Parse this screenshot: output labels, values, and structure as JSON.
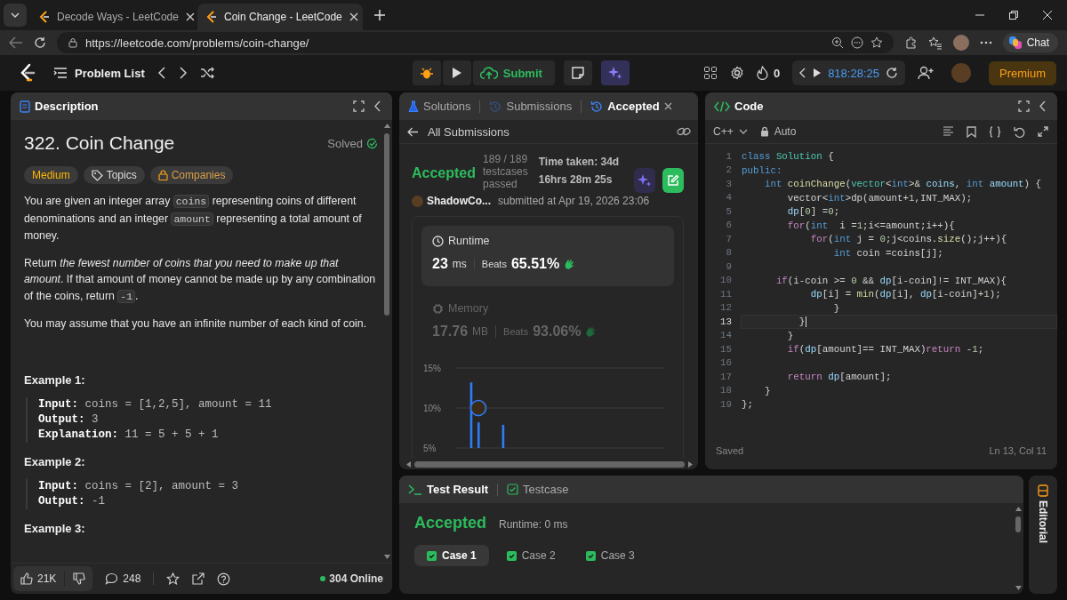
{
  "browser": {
    "tabs": [
      {
        "title": "Decode Ways - LeetCode",
        "selected": false
      },
      {
        "title": "Coin Change - LeetCode",
        "selected": true
      }
    ],
    "url": "https://leetcode.com/problems/coin-change/",
    "chat": "Chat"
  },
  "nav": {
    "problem_list": "Problem List",
    "submit": "Submit",
    "streak": "0",
    "timer": "818:28:25",
    "premium": "Premium"
  },
  "description": {
    "tab": "Description",
    "title": "322. Coin Change",
    "status": "Solved",
    "tags": [
      {
        "label": "Medium",
        "kind": "difficulty"
      },
      {
        "label": "Topics",
        "kind": "topics"
      },
      {
        "label": "Companies",
        "kind": "companies"
      }
    ],
    "paragraphs": [
      [
        {
          "text": "You are given an integer array ",
          "kind": "text"
        },
        {
          "text": "coins",
          "kind": "code"
        },
        {
          "text": " representing coins of different denominations and an integer ",
          "kind": "text"
        },
        {
          "text": "amount",
          "kind": "code"
        },
        {
          "text": " representing a total amount of money.",
          "kind": "text"
        }
      ],
      [
        {
          "text": "Return ",
          "kind": "text"
        },
        {
          "text": "the fewest number of coins that you need to make up that amount",
          "kind": "em"
        },
        {
          "text": ". If that amount of money cannot be made up by any combination of the coins, return ",
          "kind": "text"
        },
        {
          "text": "-1",
          "kind": "code"
        },
        {
          "text": ".",
          "kind": "text"
        }
      ],
      [
        {
          "text": "You may assume that you have an infinite number of each kind of coin.",
          "kind": "text"
        }
      ]
    ],
    "examples": [
      {
        "title": "Example 1:",
        "lines": [
          {
            "label": "Input:",
            "value": "coins = [1,2,5], amount = 11"
          },
          {
            "label": "Output:",
            "value": "3"
          },
          {
            "label": "Explanation:",
            "value": "11 = 5 + 5 + 1"
          }
        ]
      },
      {
        "title": "Example 2:",
        "lines": [
          {
            "label": "Input:",
            "value": "coins = [2], amount = 3"
          },
          {
            "label": "Output:",
            "value": "-1"
          }
        ]
      },
      {
        "title": "Example 3:"
      }
    ],
    "likes": "21K",
    "comments": "248",
    "online": "304 Online"
  },
  "submission": {
    "tabs": [
      {
        "label": "Solutions",
        "selected": false
      },
      {
        "label": "Submissions",
        "selected": false
      },
      {
        "label": "Accepted",
        "selected": true
      }
    ],
    "back": "All Submissions",
    "status": "Accepted",
    "tests": "189 / 189 testcases passed",
    "time_taken": "Time taken: 34d 16hrs 28m 25s",
    "user": "ShadowCo...",
    "submitted": "submitted at Apr 19, 2026 23:06",
    "metrics": [
      {
        "label": "Runtime",
        "value": "23",
        "unit": "ms",
        "beats_label": "Beats",
        "beats": "65.51%",
        "selected": true
      },
      {
        "label": "Memory",
        "value": "17.76",
        "unit": "MB",
        "beats_label": "Beats",
        "beats": "93.06%",
        "selected": false
      }
    ],
    "chart_data": {
      "type": "bar",
      "values": [
        null,
        null,
        null,
        null,
        null,
        null,
        13.2,
        null,
        null,
        8.2,
        null,
        null,
        null,
        null,
        null,
        null,
        null,
        null,
        null,
        7.9,
        null,
        null,
        null,
        null,
        null,
        null,
        null,
        null,
        null,
        null,
        null,
        null,
        null,
        null,
        null,
        null,
        null,
        null,
        null,
        null,
        null,
        null,
        null,
        null,
        null,
        null,
        null,
        null,
        null,
        null,
        null,
        null,
        null,
        null,
        null,
        null,
        null,
        null,
        null,
        null,
        null,
        null,
        null,
        null,
        null,
        null,
        null,
        null,
        null,
        null,
        null,
        null,
        null,
        null,
        null,
        null,
        null,
        null,
        null,
        null,
        null,
        null,
        null,
        null,
        null
      ],
      "ylim": [
        5,
        15
      ],
      "yticks": [
        {
          "value": 15,
          "label": "15%"
        },
        {
          "value": 10,
          "label": "10%"
        },
        {
          "value": 5,
          "label": "5%"
        }
      ]
    }
  },
  "code": {
    "tab": "Code",
    "language": "C++",
    "mode": "Auto",
    "lines": [
      {
        "num": "1",
        "current": false,
        "tokens": [
          {
            "text": "class",
            "kind": "kw"
          },
          {
            "text": " Solution",
            "kind": "type"
          },
          {
            "text": " {",
            "kind": "p"
          }
        ]
      },
      {
        "num": "2",
        "current": false,
        "tokens": [
          {
            "text": "public:",
            "kind": "kw"
          }
        ]
      },
      {
        "num": "3",
        "current": false,
        "tokens": [
          {
            "text": "    int",
            "kind": "kw"
          },
          {
            "text": " coinChange",
            "kind": "fn"
          },
          {
            "text": "(",
            "kind": "p"
          },
          {
            "text": "vector",
            "kind": "type"
          },
          {
            "text": "<",
            "kind": "p"
          },
          {
            "text": "int",
            "kind": "kw"
          },
          {
            "text": ">& ",
            "kind": "p"
          },
          {
            "text": "coins",
            "kind": "var"
          },
          {
            "text": ", ",
            "kind": "p"
          },
          {
            "text": "int",
            "kind": "kw"
          },
          {
            "text": " amount",
            "kind": "var"
          },
          {
            "text": ") {",
            "kind": "p"
          }
        ]
      },
      {
        "num": "4",
        "current": false,
        "tokens": [
          {
            "text": "        vector<",
            "kind": "p"
          },
          {
            "text": "int",
            "kind": "kw"
          },
          {
            "text": ">dp(amount+",
            "kind": "p"
          },
          {
            "text": "1",
            "kind": "num"
          },
          {
            "text": ",INT_MAX);",
            "kind": "p"
          }
        ]
      },
      {
        "num": "5",
        "current": false,
        "tokens": [
          {
            "text": "        dp",
            "kind": "var"
          },
          {
            "text": "[",
            "kind": "p"
          },
          {
            "text": "0",
            "kind": "num"
          },
          {
            "text": "] =",
            "kind": "p"
          },
          {
            "text": "0",
            "kind": "num"
          },
          {
            "text": ";",
            "kind": "p"
          }
        ]
      },
      {
        "num": "6",
        "current": false,
        "tokens": [
          {
            "text": "        for",
            "kind": "ctl"
          },
          {
            "text": "(",
            "kind": "p"
          },
          {
            "text": "int",
            "kind": "kw"
          },
          {
            "text": "  i =",
            "kind": "p"
          },
          {
            "text": "1",
            "kind": "num"
          },
          {
            "text": ";i<=amount;i++){",
            "kind": "p"
          }
        ]
      },
      {
        "num": "7",
        "current": false,
        "tokens": [
          {
            "text": "            for",
            "kind": "ctl"
          },
          {
            "text": "(",
            "kind": "p"
          },
          {
            "text": "int",
            "kind": "kw"
          },
          {
            "text": " j = ",
            "kind": "p"
          },
          {
            "text": "0",
            "kind": "num"
          },
          {
            "text": ";j<coins.",
            "kind": "p"
          },
          {
            "text": "size",
            "kind": "fn"
          },
          {
            "text": "();j++){",
            "kind": "p"
          }
        ]
      },
      {
        "num": "8",
        "current": false,
        "tokens": [
          {
            "text": "                int",
            "kind": "kw"
          },
          {
            "text": " coin =coins[j];",
            "kind": "p"
          }
        ]
      },
      {
        "num": "9",
        "current": false
      },
      {
        "num": "10",
        "current": false,
        "tokens": [
          {
            "text": "      if",
            "kind": "ctl"
          },
          {
            "text": "(i-coin >= ",
            "kind": "p"
          },
          {
            "text": "0",
            "kind": "num"
          },
          {
            "text": " && ",
            "kind": "p"
          },
          {
            "text": "dp",
            "kind": "var"
          },
          {
            "text": "[i-coin]!= INT_MAX){",
            "kind": "p"
          }
        ]
      },
      {
        "num": "11",
        "current": false,
        "tokens": [
          {
            "text": "            dp",
            "kind": "var"
          },
          {
            "text": "[i] = ",
            "kind": "p"
          },
          {
            "text": "min",
            "kind": "fn"
          },
          {
            "text": "(",
            "kind": "p"
          },
          {
            "text": "dp",
            "kind": "var"
          },
          {
            "text": "[i], ",
            "kind": "p"
          },
          {
            "text": "dp",
            "kind": "var"
          },
          {
            "text": "[i-coin]+",
            "kind": "p"
          },
          {
            "text": "1",
            "kind": "num"
          },
          {
            "text": ");",
            "kind": "p"
          }
        ]
      },
      {
        "num": "12",
        "current": false,
        "tokens": [
          {
            "text": "                }",
            "kind": "p"
          }
        ]
      },
      {
        "num": "13",
        "current": true,
        "tokens": [
          {
            "text": "          }",
            "kind": "p"
          }
        ]
      },
      {
        "num": "14",
        "current": false,
        "tokens": [
          {
            "text": "        }",
            "kind": "p"
          }
        ]
      },
      {
        "num": "15",
        "current": false,
        "tokens": [
          {
            "text": "        if",
            "kind": "ctl"
          },
          {
            "text": "(",
            "kind": "p"
          },
          {
            "text": "dp",
            "kind": "var"
          },
          {
            "text": "[amount]== INT_MAX)",
            "kind": "p"
          },
          {
            "text": "return",
            "kind": "ctl"
          },
          {
            "text": " -",
            "kind": "p"
          },
          {
            "text": "1",
            "kind": "num"
          },
          {
            "text": ";",
            "kind": "p"
          }
        ]
      },
      {
        "num": "16",
        "current": false
      },
      {
        "num": "17",
        "current": false,
        "tokens": [
          {
            "text": "        return",
            "kind": "ctl"
          },
          {
            "text": " dp",
            "kind": "var"
          },
          {
            "text": "[amount];",
            "kind": "p"
          }
        ]
      },
      {
        "num": "18",
        "current": false,
        "tokens": [
          {
            "text": "    }",
            "kind": "p"
          }
        ]
      },
      {
        "num": "19",
        "current": false,
        "tokens": [
          {
            "text": "};",
            "kind": "p"
          }
        ]
      }
    ],
    "status": "Saved",
    "position": "Ln 13, Col 11"
  },
  "test_result": {
    "tabs": [
      {
        "label": "Test Result",
        "selected": true
      },
      {
        "label": "Testcase",
        "selected": false
      }
    ],
    "status": "Accepted",
    "runtime": "Runtime: 0 ms",
    "cases": [
      {
        "label": "Case 1",
        "selected": true,
        "passed": true
      },
      {
        "label": "Case 2",
        "selected": false,
        "passed": true
      },
      {
        "label": "Case 3",
        "selected": false,
        "passed": true
      }
    ]
  },
  "editorial": {
    "label": "Editorial"
  }
}
